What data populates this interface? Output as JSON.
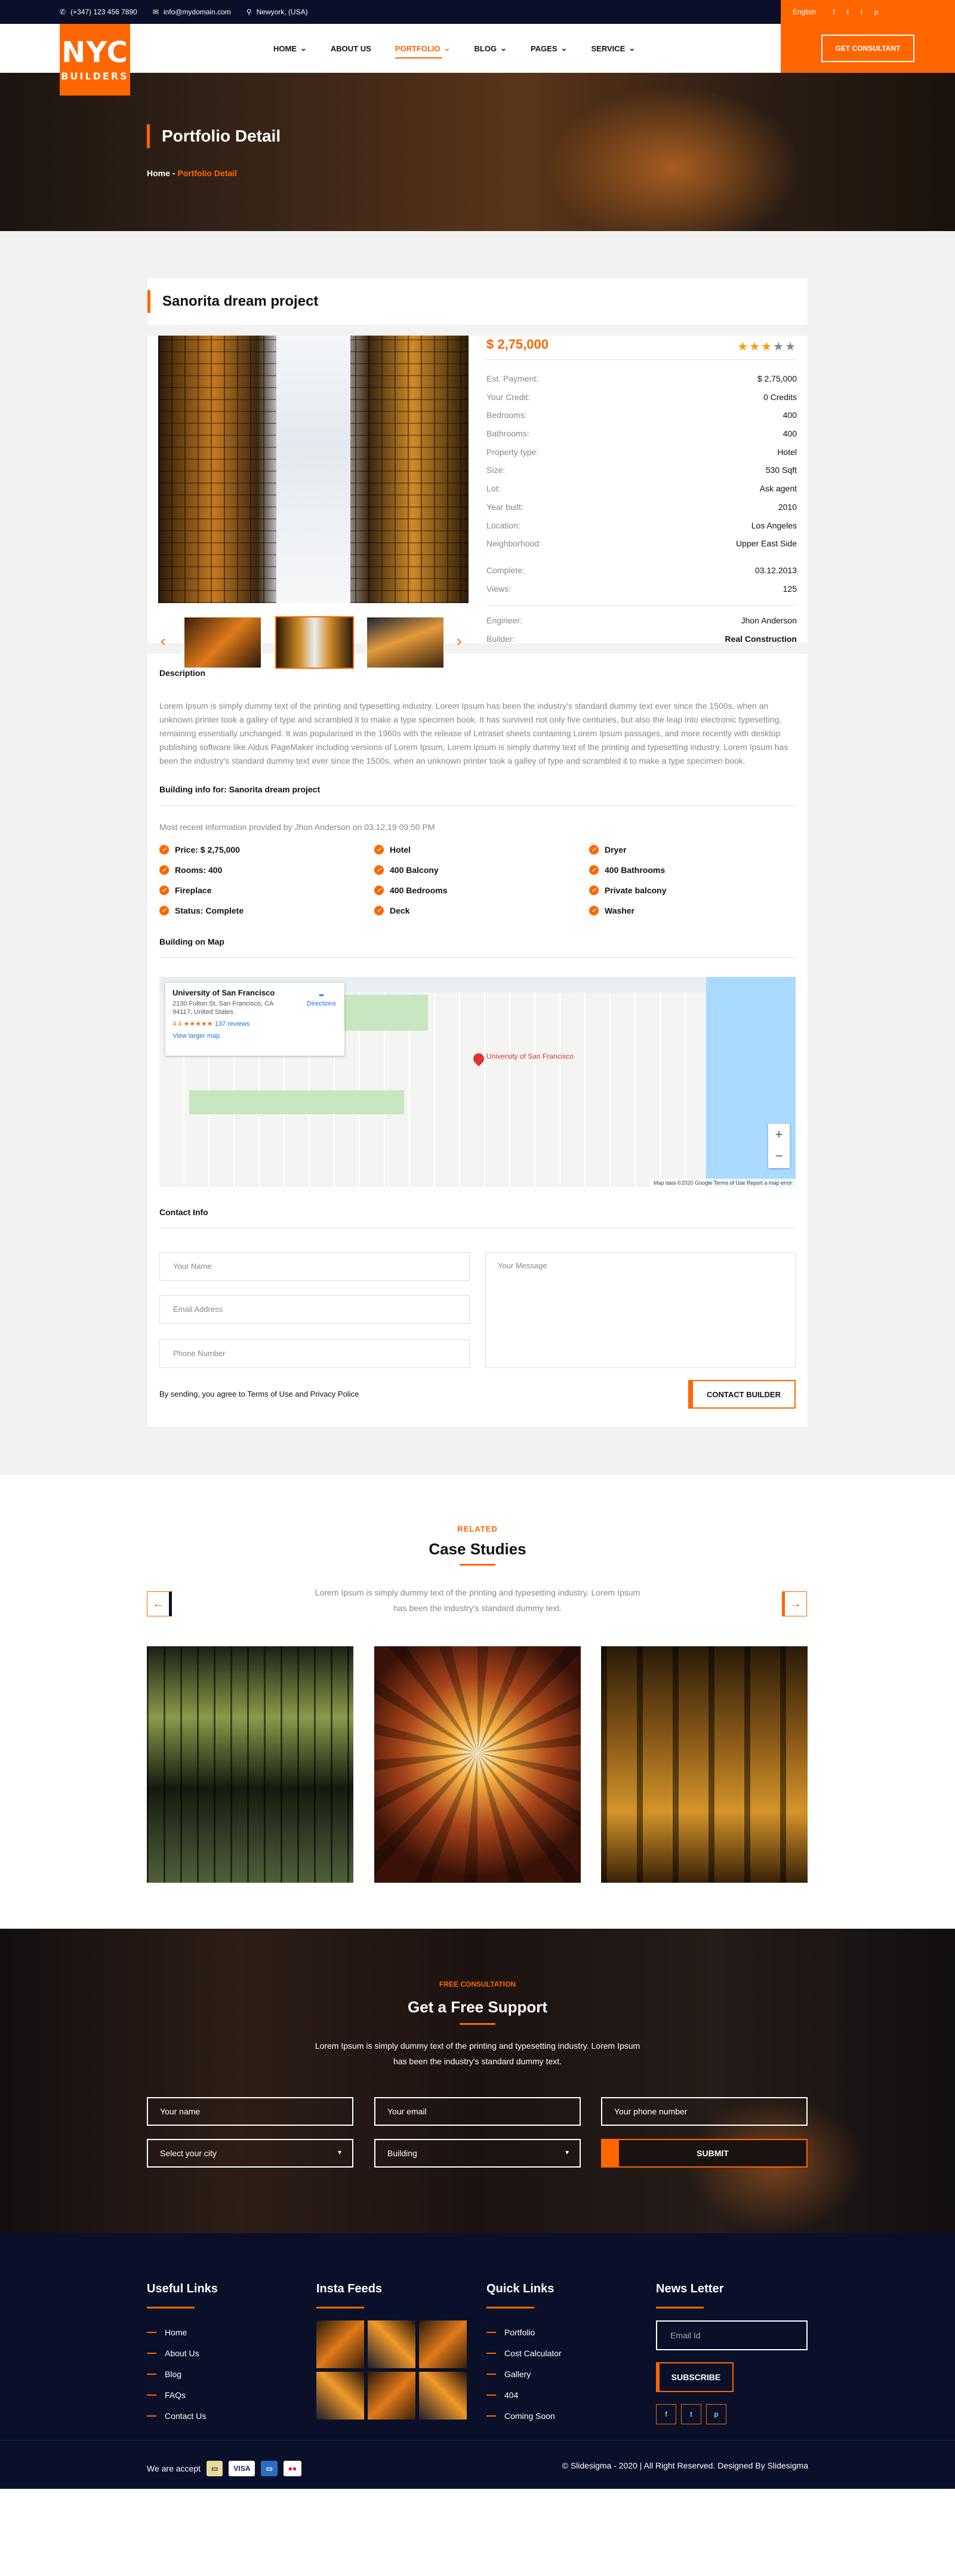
{
  "topbar": {
    "phone": "(+347) 123 456 7890",
    "email": "info@mydomain.com",
    "location": "Newyork, (USA)",
    "language": "English",
    "social": [
      "f",
      "t",
      "i",
      "p"
    ]
  },
  "logo": {
    "line1": "NYC",
    "line2": "BUILDERS"
  },
  "nav": {
    "items": [
      {
        "label": "HOME",
        "caret": "⌄"
      },
      {
        "label": "ABOUT US",
        "caret": ""
      },
      {
        "label": "PORTFOLIO",
        "caret": "⌄"
      },
      {
        "label": "BLOG",
        "caret": "⌄"
      },
      {
        "label": "PAGES",
        "caret": "⌄"
      },
      {
        "label": "SERVICE",
        "caret": "⌄"
      }
    ],
    "cta": "GET CONSULTANT"
  },
  "banner": {
    "title": "Portfolio Detail",
    "crumb_home": "Home",
    "crumb_sep": " - ",
    "crumb_current": "Portfolio Detail"
  },
  "project": {
    "title": "Sanorita dream project",
    "price": "$ 2,75,000",
    "stars": {
      "on": "★★★",
      "off": "★★"
    },
    "rows_a": [
      {
        "k": "Est. Payment:",
        "v": "$ 2,75,000"
      },
      {
        "k": "Your Credit:",
        "v": "0 Credits"
      },
      {
        "k": "Bedrooms:",
        "v": "400"
      },
      {
        "k": "Bathrooms:",
        "v": "400"
      },
      {
        "k": "Property type:",
        "v": "Hotel"
      },
      {
        "k": "Size:",
        "v": "530 Sqft"
      },
      {
        "k": "Lot:",
        "v": "Ask agent"
      },
      {
        "k": "Year built:",
        "v": "2010"
      },
      {
        "k": "Location:",
        "v": "Los Angeles"
      },
      {
        "k": "Neighborhood:",
        "v": "Upper East Side"
      }
    ],
    "rows_b": [
      {
        "k": "Complete:",
        "v": "03.12.2013"
      },
      {
        "k": "Views:",
        "v": "125"
      }
    ],
    "rows_c": [
      {
        "k": "Engineer:",
        "v": "Jhon Anderson"
      },
      {
        "k": "Builder:",
        "v": "Real Construction"
      }
    ]
  },
  "description": {
    "heading": "Description",
    "text": "Lorem Ipsum is simply dummy text of the printing and typesetting industry. Lorem Ipsum has been the industry's standard dummy text ever since the 1500s, when an unknown printer took a galley of type and scrambled it to make a type specimen book. It has survived not only five centuries, but also the leap into electronic typesetting, remaining essentially unchanged. It was popularised in the 1960s with the release of Letraset sheets containing Lorem Ipsum passages, and more recently with desktop publishing software like Aldus PageMaker including versions of Lorem Ipsum, Lorem Ipsum is simply dummy text of the printing and typesetting industry. Lorem Ipsum has been the industry's standard dummy text ever since the 1500s, when an unknown printer took a galley of type and scrambled it to make a type specimen book.",
    "building_heading": "Building info for: Sanorita dream project",
    "recent": "Most recent information provided by Jhon Anderson on 03.12.19 09:50 PM",
    "features": [
      "Price: $ 2,75,000",
      "Hotel",
      "Dryer",
      "Rooms: 400",
      "400 Balcony",
      "400 Bathrooms",
      "Fireplace",
      "400 Bedrooms",
      "Private balcony",
      "Status: Complete",
      "Deck",
      "Washer"
    ],
    "map_heading": "Building on Map"
  },
  "map": {
    "place": "University of San Francisco",
    "address": "2130 Fulton St, San Francisco, CA 94117, United States",
    "directions": "Directions",
    "rating": "4.4 ★★★★★",
    "reviews": "137 reviews",
    "larger": "View larger map",
    "pin_label": "University of San Francisco",
    "footer": "Map data ©2020 Google   Terms of Use   Report a map error",
    "zoom_in": "+",
    "zoom_out": "−"
  },
  "contact": {
    "heading": "Contact Info",
    "name_ph": "Your Name",
    "email_ph": "Email Address",
    "phone_ph": "Phone Number",
    "message_ph": "Your Message",
    "terms": "By sending, you agree to Terms of Use and Privacy Police",
    "button": "CONTACT BUILDER"
  },
  "related": {
    "eyebrow": "RELATED",
    "title": "Case Studies",
    "text": "Lorem Ipsum is simply dummy text of the printing and typesetting industry. Lorem Ipsum has been the industry's standard dummy text.",
    "prev": "←",
    "next": "→"
  },
  "consult": {
    "eyebrow": "FREE CONSULTATION",
    "title": "Get a Free Support",
    "text": "Lorem Ipsum is simply dummy text of the printing and typesetting industry. Lorem Ipsum has been the industry's standard dummy text.",
    "name_ph": "Your name",
    "email_ph": "Your email",
    "phone_ph": "Your phone number",
    "city_ph": "Select your city",
    "building_ph": "Building",
    "submit": "SUBMIT"
  },
  "footer": {
    "useful_title": "Useful Links",
    "useful": [
      "Home",
      "About Us",
      "Blog",
      "FAQs",
      "Contact Us"
    ],
    "insta_title": "Insta Feeds",
    "quick_title": "Quick Links",
    "quick": [
      "Portfolio",
      "Cost Calculator",
      "Gallery",
      "404",
      "Coming Soon"
    ],
    "news_title": "News Letter",
    "email_ph": "Email Id",
    "subscribe": "SUBSCRIBE",
    "social": [
      "f",
      "t",
      "p"
    ],
    "accept": "We are accept",
    "cards": [
      "▭",
      "VISA",
      "▭",
      "●●"
    ],
    "copyright": "© Slidesigma - 2020 | All Right Reserved. Designed By Slidesigma"
  }
}
